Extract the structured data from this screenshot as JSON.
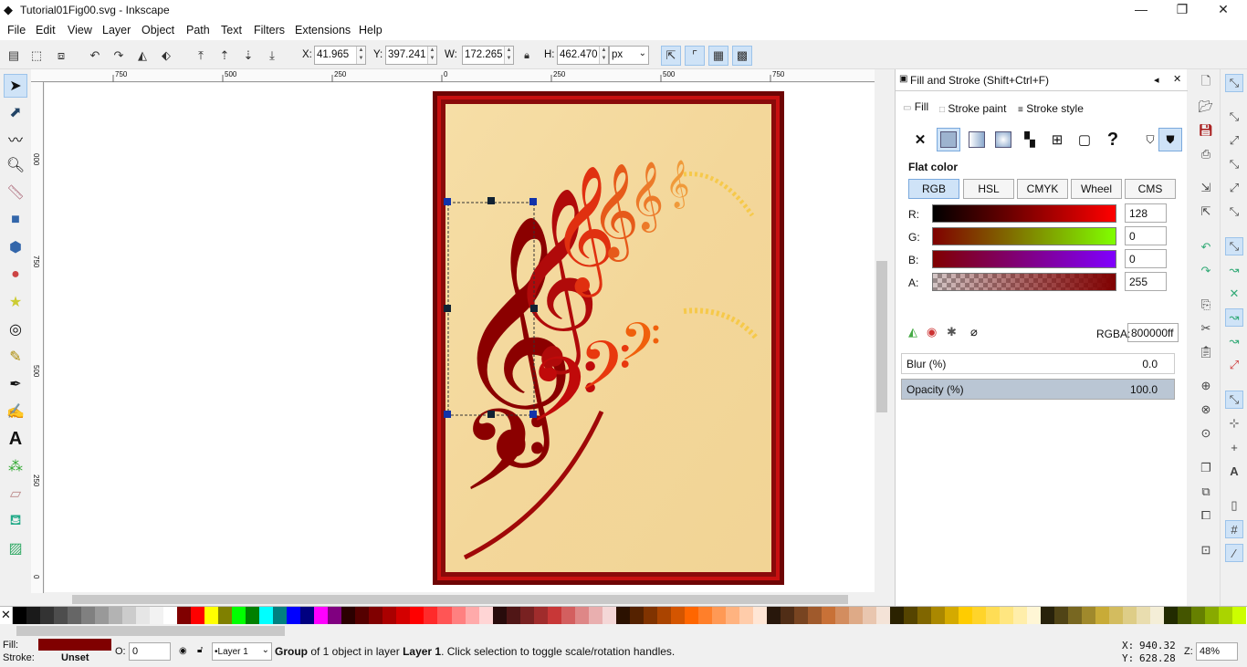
{
  "window": {
    "title": "Tutorial01Fig00.svg - Inkscape",
    "minimize": "—",
    "maximize": "❐",
    "close": "✕"
  },
  "menu": [
    "File",
    "Edit",
    "View",
    "Layer",
    "Object",
    "Path",
    "Text",
    "Filters",
    "Extensions",
    "Help"
  ],
  "toolbar": {
    "x_label": "X:",
    "x_value": "41.965",
    "y_label": "Y:",
    "y_value": "397.241",
    "w_label": "W:",
    "w_value": "172.265",
    "h_label": "H:",
    "h_value": "462.470",
    "unit": "px"
  },
  "ruler": {
    "h_ticks": [
      "750",
      "500",
      "250",
      "0",
      "250",
      "500",
      "750"
    ],
    "v_ticks": [
      "000",
      "750",
      "500",
      "250",
      "0"
    ]
  },
  "panel": {
    "title": "Fill and Stroke (Shift+Ctrl+F)",
    "tabs": [
      "Fill",
      "Stroke paint",
      "Stroke style"
    ],
    "mode_title": "Flat color",
    "modes": [
      "RGB",
      "HSL",
      "CMYK",
      "Wheel",
      "CMS"
    ],
    "channels": [
      {
        "label": "R:",
        "value": "128"
      },
      {
        "label": "G:",
        "value": "0"
      },
      {
        "label": "B:",
        "value": "0"
      },
      {
        "label": "A:",
        "value": "255"
      }
    ],
    "rgba_label": "RGBA:",
    "rgba_value": "800000ff",
    "blur_label": "Blur (%)",
    "blur_value": "0.0",
    "opacity_label": "Opacity (%)",
    "opacity_value": "100.0",
    "no_paint": "✕",
    "unset": "?"
  },
  "status": {
    "fill_label": "Fill:",
    "stroke_label": "Stroke:",
    "stroke_value": "Unset",
    "fill_color": "#800000",
    "o_label": "O:",
    "o_value": "0",
    "layer": "•Layer 1",
    "message_pre": "Group",
    "message_mid": " of 1 object in layer ",
    "message_layer": "Layer 1",
    "message_post": ". Click selection to toggle scale/rotation handles.",
    "cursor_x_label": "X:",
    "cursor_x": "940.32",
    "cursor_y_label": "Y:",
    "cursor_y": "628.28",
    "zoom_label": "Z:",
    "zoom": "48%"
  },
  "palette": [
    "#000000",
    "#1a1a1a",
    "#333333",
    "#4d4d4d",
    "#666666",
    "#808080",
    "#999999",
    "#b3b3b3",
    "#cccccc",
    "#e6e6e6",
    "#f2f2f2",
    "#ffffff",
    "#800000",
    "#ff0000",
    "#ffff00",
    "#808000",
    "#00ff00",
    "#008000",
    "#00ffff",
    "#008080",
    "#0000ff",
    "#000080",
    "#ff00ff",
    "#800080",
    "#2b0000",
    "#550000",
    "#800000",
    "#aa0000",
    "#d40000",
    "#ff0000",
    "#ff2a2a",
    "#ff5555",
    "#ff8080",
    "#ffaaaa",
    "#ffd5d5",
    "#280b0b",
    "#501616",
    "#782121",
    "#a02c2c",
    "#c83737",
    "#d35f5f",
    "#de8787",
    "#e9afaf",
    "#f4d7d7",
    "#2b1100",
    "#552200",
    "#803300",
    "#aa4400",
    "#d45500",
    "#ff6600",
    "#ff7f2a",
    "#ff9955",
    "#ffb380",
    "#ffccaa",
    "#ffe6d5",
    "#28170b",
    "#502d16",
    "#784421",
    "#a05a2c",
    "#c87137",
    "#d38d5f",
    "#deaa87",
    "#e9c6af",
    "#f4e3d7",
    "#2b2200",
    "#554400",
    "#806600",
    "#aa8800",
    "#d4aa00",
    "#ffcc00",
    "#ffd42a",
    "#ffdd55",
    "#ffe680",
    "#ffeeaa",
    "#fff6d5",
    "#28220b",
    "#504416",
    "#786721",
    "#a0892c",
    "#c8ab37",
    "#d3bc5f",
    "#decd87",
    "#e9ddaf",
    "#f4eed7",
    "#222b00",
    "#445500",
    "#668000",
    "#88aa00",
    "#aad400",
    "#ccff00"
  ]
}
